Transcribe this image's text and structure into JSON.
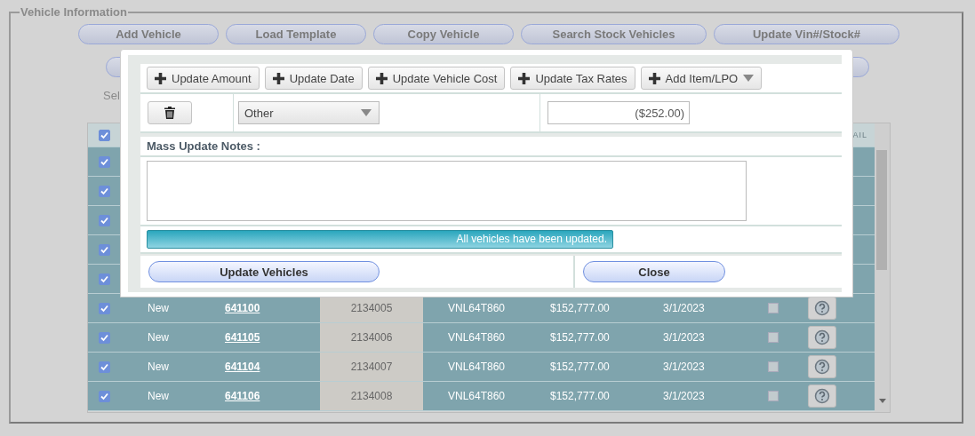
{
  "section": {
    "title": "Vehicle Information"
  },
  "actions": [
    "Add Vehicle",
    "Load Template",
    "Copy Vehicle",
    "Search Stock Vehicles",
    "Update Vin#/Stock#"
  ],
  "selection_label": "Sel",
  "table": {
    "header_checked": true,
    "column_9": "AIL",
    "rows": [
      {
        "checked": true
      },
      {
        "checked": true
      },
      {
        "checked": true
      },
      {
        "checked": true
      },
      {
        "checked": true
      },
      {
        "checked": true,
        "status": "New",
        "stock": "641100",
        "column_4": "2134005",
        "model": "VNL64T860",
        "price": "$152,777.00",
        "date": "3/1/2023",
        "flagged": false
      },
      {
        "checked": true,
        "status": "New",
        "stock": "641105",
        "column_4": "2134006",
        "model": "VNL64T860",
        "price": "$152,777.00",
        "date": "3/1/2023",
        "flagged": false
      },
      {
        "checked": true,
        "status": "New",
        "stock": "641104",
        "column_4": "2134007",
        "model": "VNL64T860",
        "price": "$152,777.00",
        "date": "3/1/2023",
        "flagged": false
      },
      {
        "checked": true,
        "status": "New",
        "stock": "641106",
        "column_4": "2134008",
        "model": "VNL64T860",
        "price": "$152,777.00",
        "date": "3/1/2023",
        "flagged": false
      }
    ]
  },
  "dialog": {
    "toolbar": [
      {
        "label": "Update Amount",
        "kind": "plain"
      },
      {
        "label": "Update Date",
        "kind": "plain"
      },
      {
        "label": "Update Vehicle Cost",
        "kind": "plain"
      },
      {
        "label": "Update Tax Rates",
        "kind": "plain"
      },
      {
        "label": "Add Item/LPO",
        "kind": "dropdown"
      }
    ],
    "item_type": "Other",
    "amount": "($252.00)",
    "notes_label": "Mass Update Notes :",
    "status_message": "All vehicles have been updated.",
    "primary_button": "Update Vehicles",
    "close_button": "Close"
  }
}
